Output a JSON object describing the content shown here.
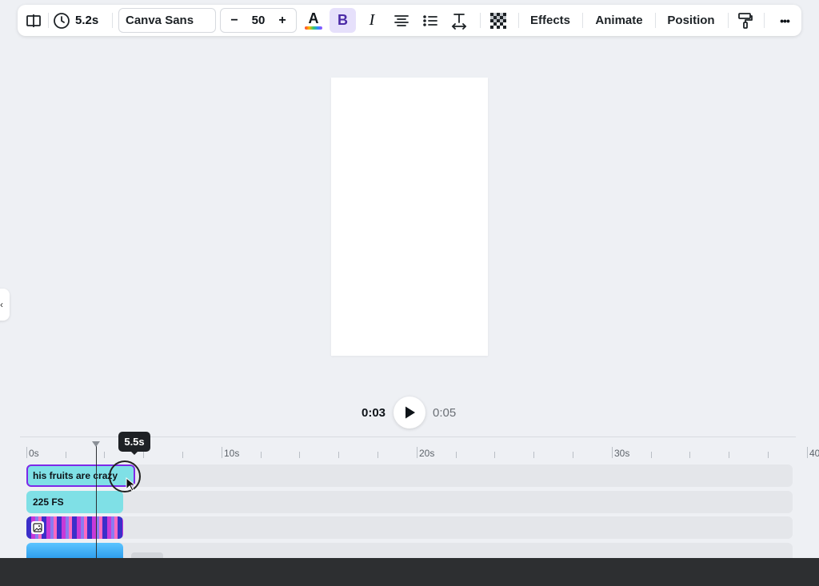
{
  "toolbar": {
    "duration": "5.2s",
    "font_family": "Canva Sans",
    "font_size": "50",
    "decrease_label": "−",
    "increase_label": "+",
    "bold_label": "B",
    "italic_label": "I",
    "effects_label": "Effects",
    "animate_label": "Animate",
    "position_label": "Position",
    "text_color_letter": "A",
    "more_label": "•••",
    "icons": [
      "page-flip-icon",
      "clock-icon",
      "text-color-icon",
      "bold-icon",
      "italic-icon",
      "align-center-icon",
      "list-icon",
      "spacing-icon",
      "transparency-icon",
      "paint-roller-icon",
      "more-icon"
    ]
  },
  "playback": {
    "current_time": "0:03",
    "total_time": "0:05"
  },
  "timeline": {
    "ruler_labels": [
      "0s",
      "10s",
      "20s",
      "30s",
      "40"
    ],
    "tooltip": "5.5s",
    "tracks": [
      {
        "label": "his fruits are crazy",
        "color": "#7fe0e6",
        "selected": true
      },
      {
        "label": "225 FS",
        "color": "#7fe0e6"
      },
      {
        "label": "",
        "type": "image"
      },
      {
        "label": "",
        "type": "video"
      }
    ]
  },
  "colors": {
    "accent": "#7d2ae8",
    "bold_active_bg": "#e6e0fb",
    "clip_cyan": "#7fe0e6"
  }
}
